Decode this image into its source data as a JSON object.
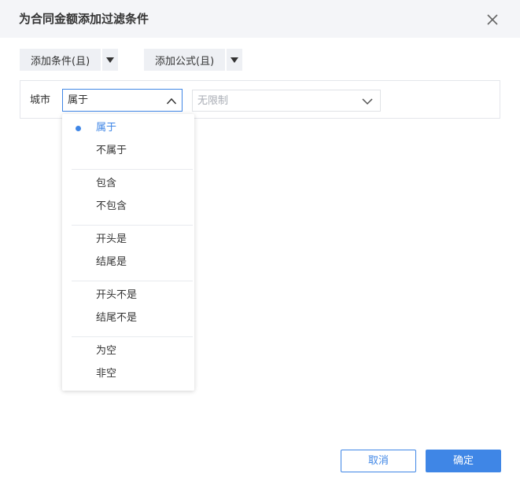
{
  "dialog": {
    "title": "为合同金额添加过滤条件"
  },
  "toolbar": {
    "add_condition_label": "添加条件(且)",
    "add_formula_label": "添加公式(且)"
  },
  "condition": {
    "field_label": "城市",
    "operator_value": "属于",
    "value_placeholder": "无限制"
  },
  "operator_options": {
    "selected_index": 0,
    "groups": [
      [
        "属于",
        "不属于"
      ],
      [
        "包含",
        "不包含"
      ],
      [
        "开头是",
        "结尾是"
      ],
      [
        "开头不是",
        "结尾不是"
      ],
      [
        "为空",
        "非空"
      ]
    ]
  },
  "footer": {
    "cancel_label": "取消",
    "ok_label": "确定"
  },
  "colors": {
    "accent": "#3f86e6",
    "header_bg": "#f4f5f8",
    "button_bg": "#eef0f4"
  }
}
